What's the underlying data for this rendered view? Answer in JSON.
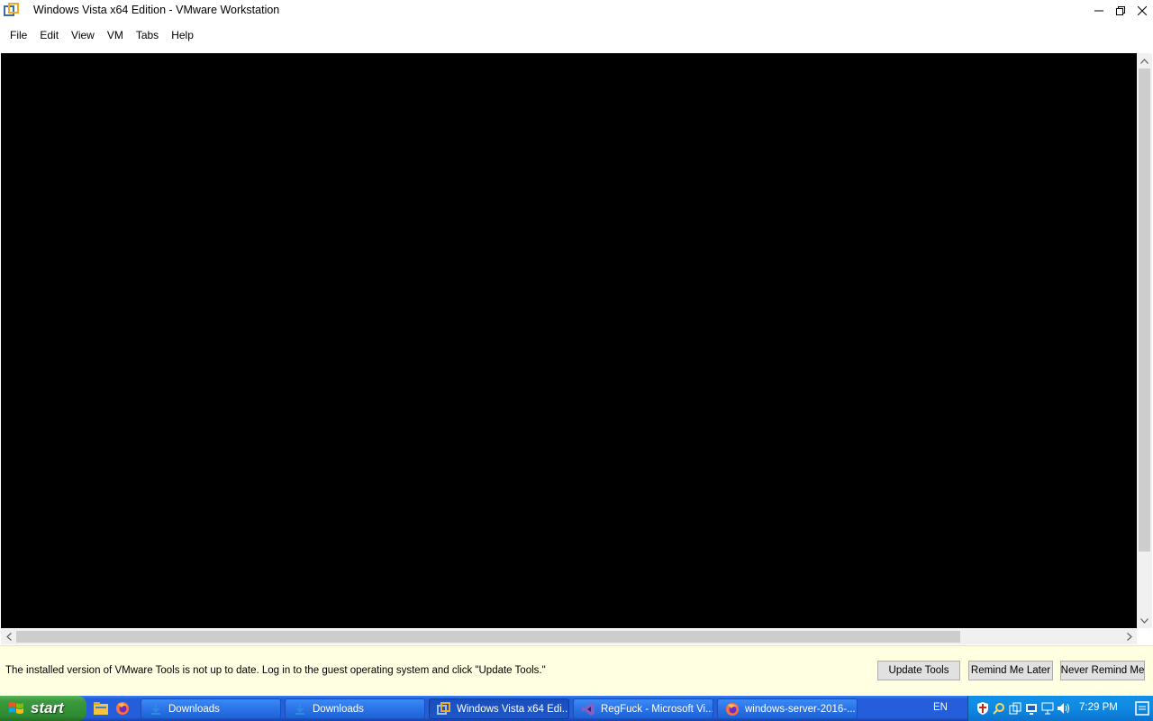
{
  "window": {
    "title": "Windows Vista x64 Edition - VMware Workstation"
  },
  "menu": {
    "items": [
      {
        "label": "File"
      },
      {
        "label": "Edit"
      },
      {
        "label": "View"
      },
      {
        "label": "VM"
      },
      {
        "label": "Tabs"
      },
      {
        "label": "Help"
      }
    ]
  },
  "notification": {
    "message": "The installed version of VMware Tools is not up to date. Log in to the guest operating system and click \"Update Tools.\"",
    "buttons": {
      "update": "Update Tools",
      "remind_later": "Remind Me Later",
      "never_remind": "Never Remind Me"
    }
  },
  "taskbar": {
    "start_label": "start",
    "quicklaunch": [
      {
        "icon": "file-explorer-icon"
      },
      {
        "icon": "firefox-icon"
      }
    ],
    "tasks": [
      {
        "label": "Downloads",
        "icon": "download-folder-icon",
        "active": false
      },
      {
        "label": "Downloads",
        "icon": "download-folder-icon",
        "active": false
      },
      {
        "label": "Windows Vista x64 Edi...",
        "icon": "vmware-icon",
        "active": true
      },
      {
        "label": "RegFuck - Microsoft Vi...",
        "icon": "visual-studio-icon",
        "active": false
      },
      {
        "label": "windows-server-2016-...",
        "icon": "firefox-icon",
        "active": false
      }
    ],
    "language": "EN",
    "clock": "7:29 PM"
  },
  "colors": {
    "vm_background": "#000000",
    "notification_background": "#ffffe1",
    "taskbar_blue": "#245edb",
    "start_green": "#3c9b3e",
    "tray_blue": "#0f8ae0"
  }
}
